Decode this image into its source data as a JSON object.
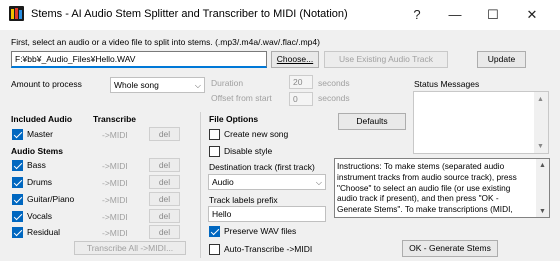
{
  "window": {
    "title": "Stems - AI Audio Stem Splitter and Transcriber to MIDI (Notation)",
    "controls": {
      "help": "?",
      "minimize": "—",
      "maximize": "☐",
      "close": "✕"
    }
  },
  "file": {
    "instruction": "First, select an audio or a video file to split into stems. (.mp3/.m4a/.wav/.flac/.mp4)",
    "path": "F:¥bb¥_Audio_Files¥Hello.WAV",
    "choose_label": "Choose...",
    "use_existing_label": "Use Existing Audio Track",
    "update_label": "Update"
  },
  "process": {
    "label": "Amount to process",
    "selected": "Whole song",
    "duration_label": "Duration",
    "duration_value": "20",
    "duration_unit": "seconds",
    "offset_label": "Offset from start",
    "offset_value": "0",
    "offset_unit": "seconds"
  },
  "status": {
    "label": "Status Messages"
  },
  "audio": {
    "included_header": "Included Audio",
    "transcribe_header": "Transcribe",
    "master": {
      "label": "Master",
      "midi": "->MIDI",
      "del": "del",
      "checked": true
    },
    "stems_header": "Audio Stems",
    "stems": [
      {
        "label": "Bass",
        "midi": "->MIDI",
        "del": "del",
        "checked": true
      },
      {
        "label": "Drums",
        "midi": "->MIDI",
        "del": "del",
        "checked": true
      },
      {
        "label": "Guitar/Piano",
        "midi": "->MIDI",
        "del": "del",
        "checked": true
      },
      {
        "label": "Vocals",
        "midi": "->MIDI",
        "del": "del",
        "checked": true
      },
      {
        "label": "Residual",
        "midi": "->MIDI",
        "del": "del",
        "checked": true
      }
    ],
    "transcribe_all_label": "Transcribe All ->MIDI..."
  },
  "options": {
    "header": "File Options",
    "create_new_song": "Create new song",
    "disable_style": "Disable style",
    "destination_label": "Destination track (first track)",
    "destination_value": "Audio",
    "prefix_label": "Track labels prefix",
    "prefix_value": "Hello",
    "preserve_wav": "Preserve WAV files",
    "auto_transcribe": "Auto-Transcribe ->MIDI"
  },
  "defaults_label": "Defaults",
  "instructions": {
    "lines": [
      "Instructions: To make stems (separated audio",
      "instrument tracks from audio source track), press",
      "\"Choose\" to select an audio file (or use existing",
      "audio track if present), and then press \"OK -",
      "Generate Stems\". To make transcriptions (MIDI,"
    ]
  },
  "ok_label": "OK - Generate Stems",
  "colors": {
    "accent": "#0067c0",
    "focus_border": "#0078d7"
  }
}
